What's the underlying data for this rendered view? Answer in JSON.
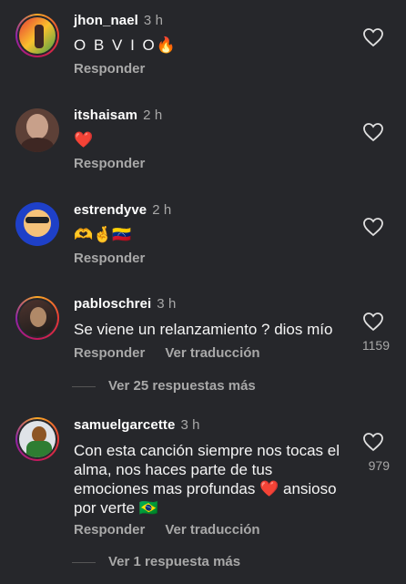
{
  "comments": [
    {
      "username": "jhon_nael",
      "time": "3 h",
      "text": "O B V I O🔥",
      "reply": "Responder"
    },
    {
      "username": "itshaisam",
      "time": "2 h",
      "text": "❤️",
      "reply": "Responder"
    },
    {
      "username": "estrendyve",
      "time": "2 h",
      "text": "🫶🤞🇻🇪",
      "reply": "Responder"
    },
    {
      "username": "pabloschrei",
      "time": "3 h",
      "text": "Se viene un relanzamiento ? dios mío",
      "reply": "Responder",
      "translate": "Ver traducción",
      "likes": "1159",
      "more": "Ver 25 respuestas más"
    },
    {
      "username": "samuelgarcette",
      "time": "3 h",
      "text": "Con esta canción siempre nos tocas el alma, nos haces parte de tus emociones mas profundas ❤️ ansioso por verte 🇧🇷",
      "reply": "Responder",
      "translate": "Ver traducción",
      "likes": "979",
      "more": "Ver 1 respuesta más"
    }
  ],
  "icons": {
    "like": "heart-outline-icon"
  },
  "colors": {
    "background": "#26272b",
    "muted": "#a8a8a8"
  }
}
